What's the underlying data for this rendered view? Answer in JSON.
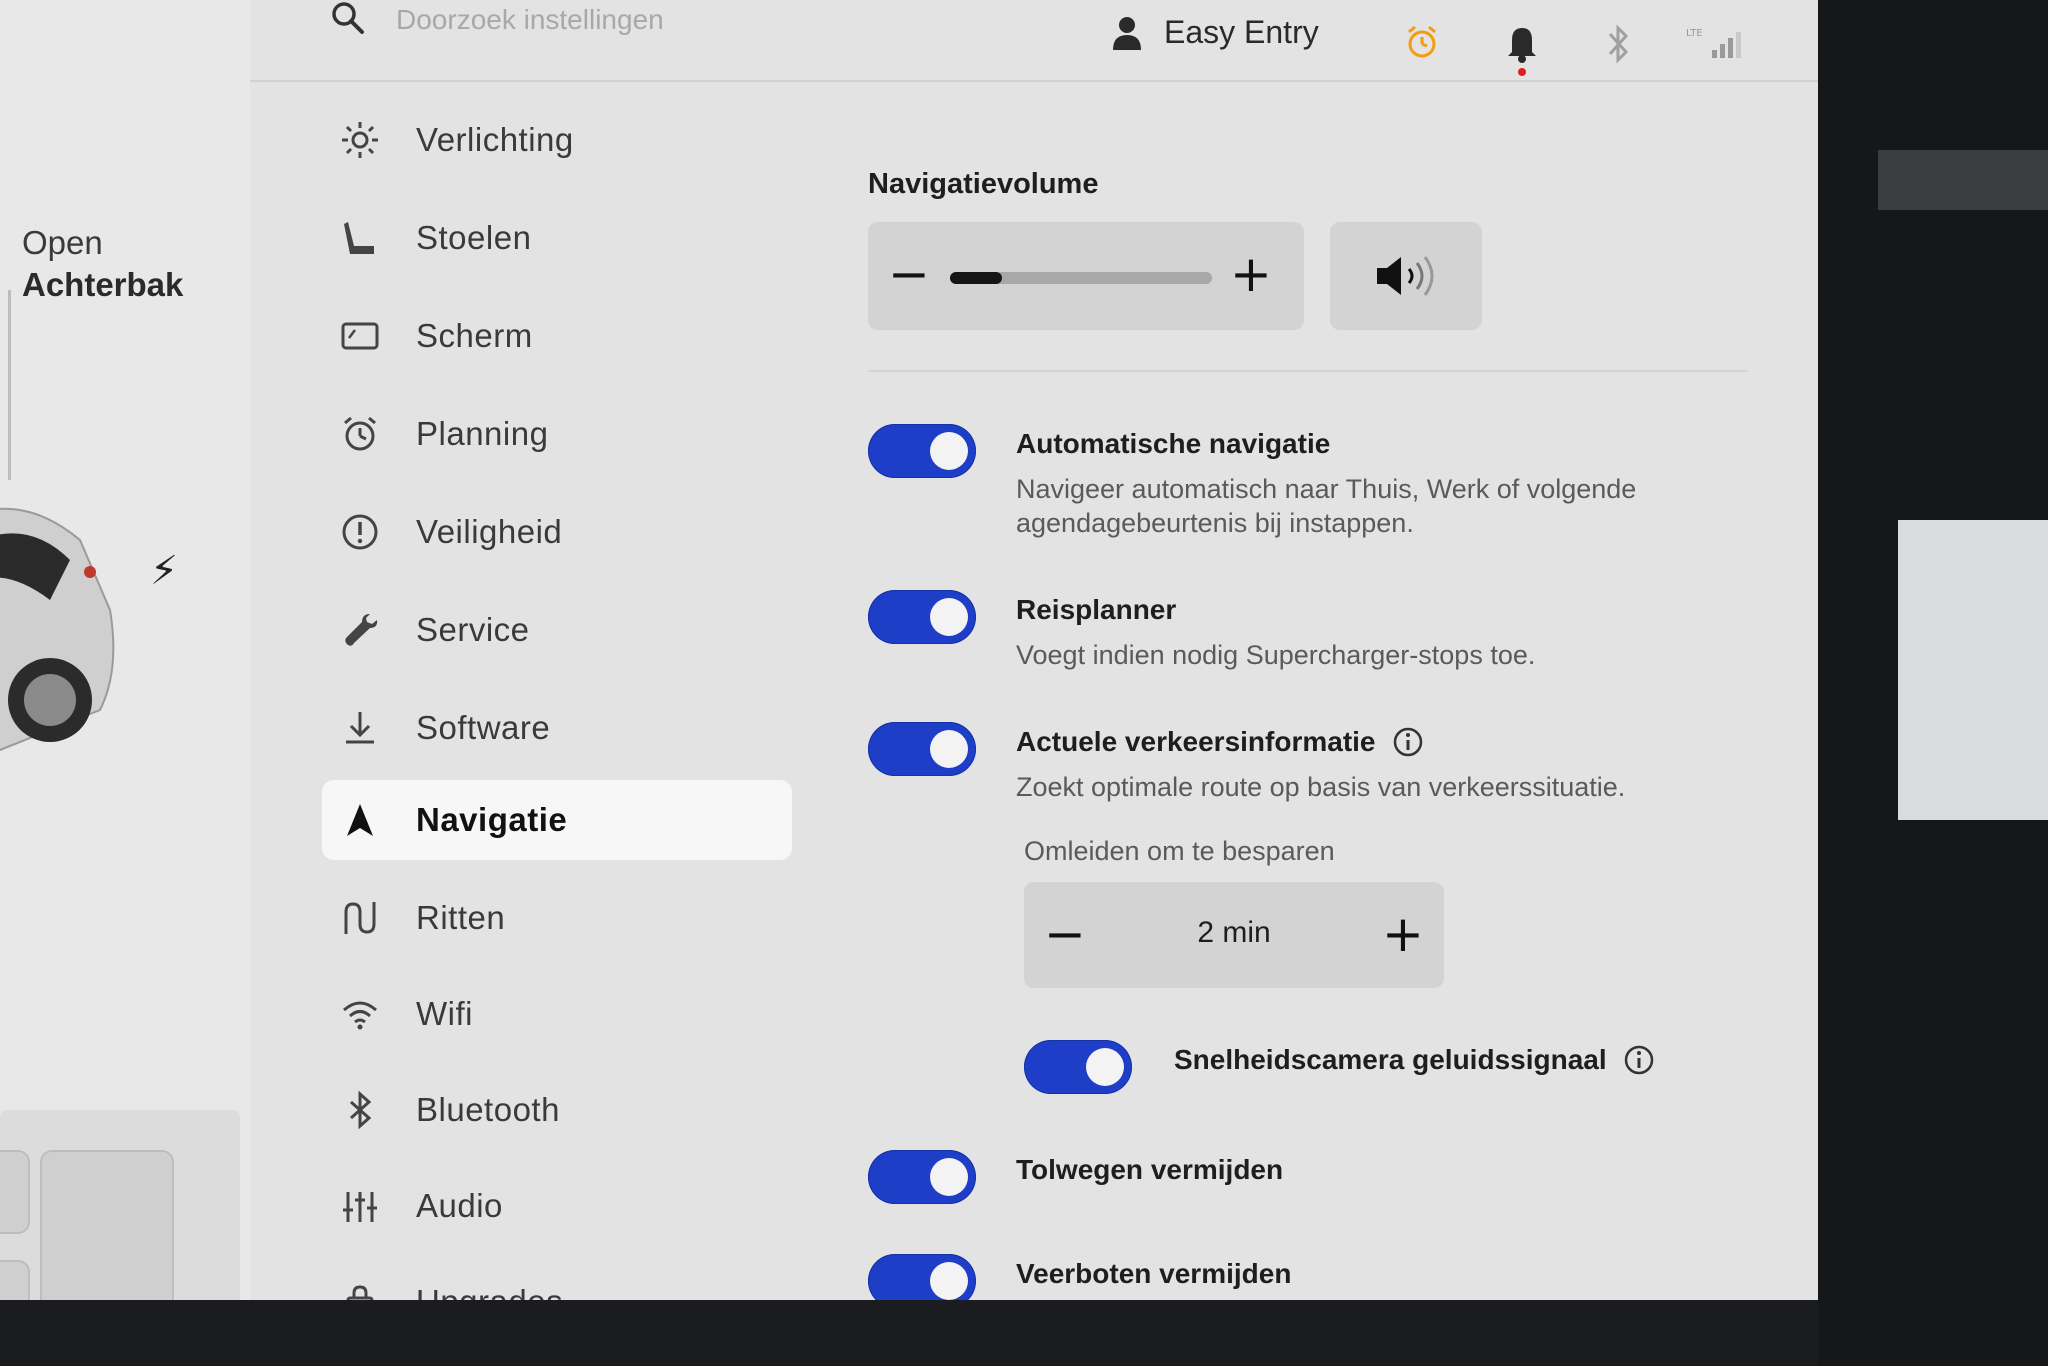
{
  "search": {
    "placeholder": "Doorzoek instellingen"
  },
  "profile": {
    "label": "Easy Entry"
  },
  "status_icons": [
    "alarm-clock-icon",
    "bell-icon",
    "bluetooth-icon",
    "lte-signal-icon"
  ],
  "status_colors": {
    "alarm": "#f39c12",
    "notification_dot": "#e02020"
  },
  "car": {
    "trunk_line1": "Open",
    "trunk_line2": "Achterbak"
  },
  "menu": {
    "items": [
      {
        "label": "Verlichting",
        "icon": "sun-icon"
      },
      {
        "label": "Stoelen",
        "icon": "seat-icon"
      },
      {
        "label": "Scherm",
        "icon": "display-icon"
      },
      {
        "label": "Planning",
        "icon": "alarm-clock-icon"
      },
      {
        "label": "Veiligheid",
        "icon": "alert-circle-icon"
      },
      {
        "label": "Service",
        "icon": "wrench-icon"
      },
      {
        "label": "Software",
        "icon": "download-icon"
      },
      {
        "label": "Navigatie",
        "icon": "navigation-arrow-icon",
        "active": true
      },
      {
        "label": "Ritten",
        "icon": "trips-icon"
      },
      {
        "label": "Wifi",
        "icon": "wifi-icon"
      },
      {
        "label": "Bluetooth",
        "icon": "bluetooth-icon"
      },
      {
        "label": "Audio",
        "icon": "equalizer-icon"
      },
      {
        "label": "Upgrades",
        "icon": "shopping-bag-icon"
      }
    ]
  },
  "navigation": {
    "volume_title": "Navigatievolume",
    "volume_minus": "−",
    "volume_plus": "+",
    "volume_level": 0.2,
    "settings": [
      {
        "title": "Automatische navigatie",
        "desc": "Navigeer automatisch naar Thuis, Werk of volgende agendagebeurtenis bij instappen.",
        "on": true
      },
      {
        "title": "Reisplanner",
        "desc": "Voegt indien nodig Supercharger-stops toe.",
        "on": true
      },
      {
        "title": "Actuele verkeersinformatie",
        "desc": "Zoekt optimale route op basis van verkeerssituatie.",
        "on": true
      },
      {
        "title": "Snelheidscamera geluidssignaal",
        "on": true
      },
      {
        "title": "Tolwegen vermijden",
        "on": true
      },
      {
        "title": "Veerboten vermijden",
        "on": true
      }
    ],
    "reroute_label": "Omleiden om te besparen",
    "reroute_value": "2 min",
    "reroute_minus": "−",
    "reroute_plus": "+"
  },
  "accent_color": "#1e3ec8"
}
